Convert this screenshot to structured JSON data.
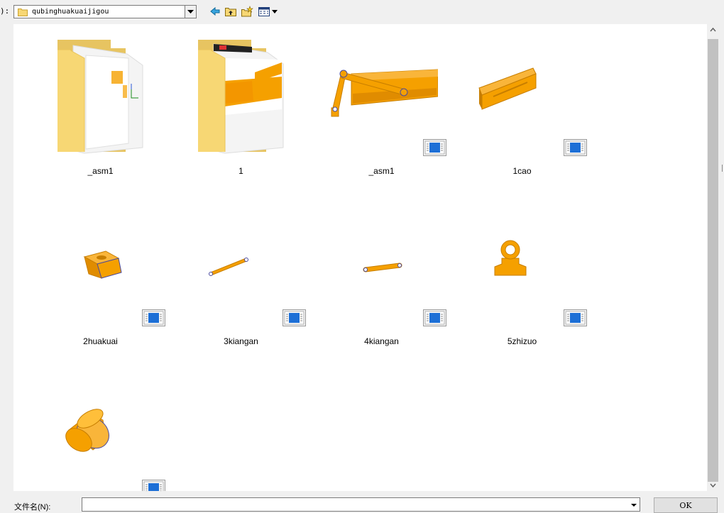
{
  "toolbar": {
    "lookin_label": "):",
    "path": "qubinghuakuaijigou",
    "icons": [
      "folder-icon",
      "dropdown-arrow-icon",
      "back-arrow-icon",
      "up-folder-icon",
      "new-folder-icon",
      "view-menu-icon"
    ]
  },
  "files": [
    {
      "name": "_asm1",
      "type": "folder"
    },
    {
      "name": "1",
      "type": "folder"
    },
    {
      "name": "_asm1",
      "type": "assembly"
    },
    {
      "name": "1cao",
      "type": "part"
    },
    {
      "name": "2huakuai",
      "type": "part"
    },
    {
      "name": "3kiangan",
      "type": "part"
    },
    {
      "name": "4kiangan",
      "type": "part"
    },
    {
      "name": "5zhizuo",
      "type": "part"
    },
    {
      "name": "",
      "type": "part"
    }
  ],
  "filename": {
    "label": "文件名(N):",
    "value": ""
  },
  "ok_label": "OK",
  "colors": {
    "part_orange": "#f5a000",
    "part_shadow": "#c77e00",
    "folder_yellow": "#f7d774",
    "badge_blue": "#1d6fd6"
  }
}
